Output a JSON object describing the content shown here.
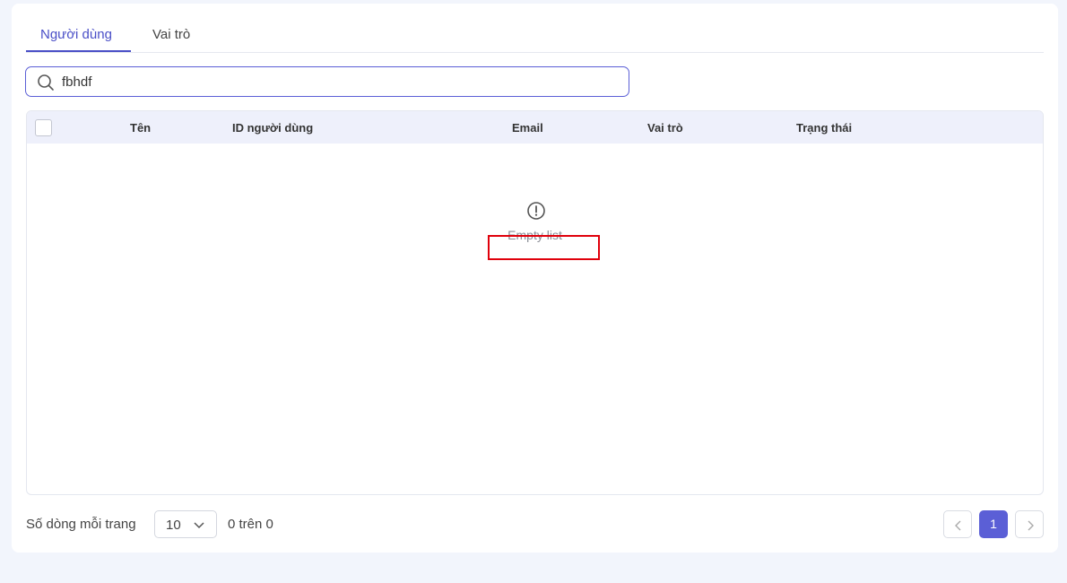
{
  "tabs": [
    {
      "label": "Người dùng",
      "active": true
    },
    {
      "label": "Vai trò",
      "active": false
    }
  ],
  "search": {
    "value": "fbhdf",
    "icon": "search-icon"
  },
  "table": {
    "columns": [
      "Tên",
      "ID người dùng",
      "Email",
      "Vai trò",
      "Trạng thái"
    ],
    "rows": [],
    "empty_icon": "alert-circle-icon",
    "empty_text": "Empty list"
  },
  "footer": {
    "rows_per_page_label": "Số dòng mỗi trang",
    "rows_per_page_value": "10",
    "range_text": "0 trên 0",
    "current_page": "1"
  },
  "colors": {
    "accent": "#5b5fd6",
    "tab_active": "#4a4fc7",
    "header_bg": "#eef0fb",
    "page_bg": "#f2f5fc",
    "highlight_box": "#e0000b"
  }
}
